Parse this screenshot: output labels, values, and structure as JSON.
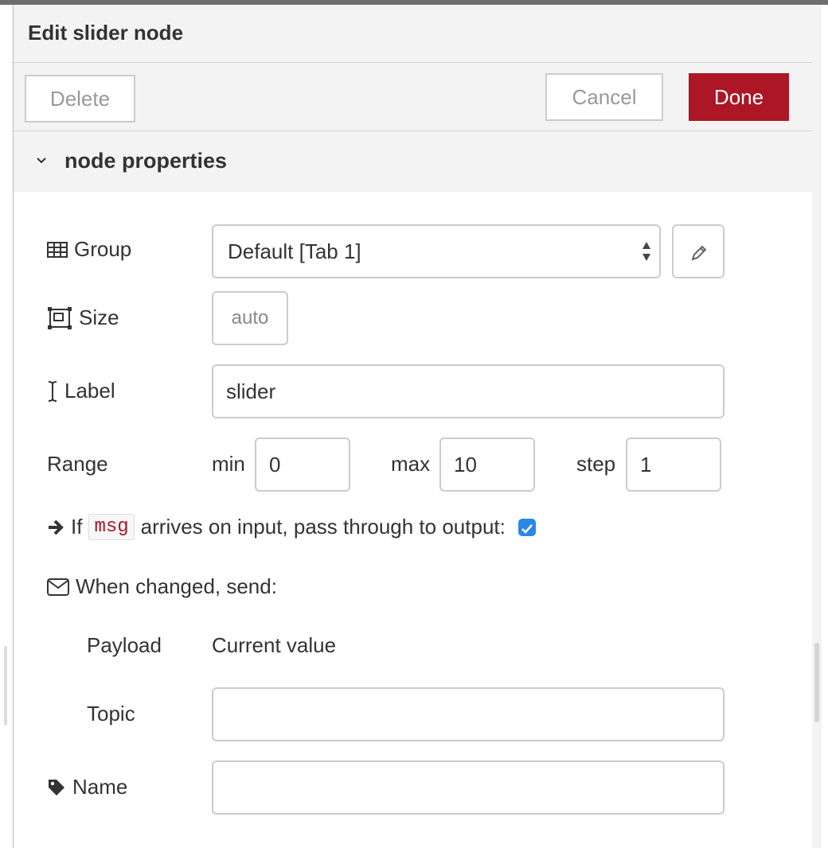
{
  "tray": {
    "title": "Edit slider node",
    "delete_label": "Delete",
    "cancel_label": "Cancel",
    "done_label": "Done"
  },
  "section": {
    "title": "node properties"
  },
  "form": {
    "group": {
      "label": "Group",
      "value": "Default [Tab 1]"
    },
    "size": {
      "label": "Size",
      "value": "auto"
    },
    "label": {
      "label": "Label",
      "value": "slider"
    },
    "range": {
      "label": "Range",
      "min_label": "min",
      "min_value": "0",
      "max_label": "max",
      "max_value": "10",
      "step_label": "step",
      "step_value": "1"
    },
    "passthrough": {
      "prefix": "If",
      "code": "msg",
      "suffix": "arrives on input, pass through to output:",
      "checked": true
    },
    "send": {
      "label": "When changed, send:",
      "payload_label": "Payload",
      "payload_value": "Current value",
      "topic_label": "Topic",
      "topic_value": ""
    },
    "name": {
      "label": "Name",
      "value": ""
    }
  },
  "colors": {
    "done_button": "#ad1625",
    "code_text": "#ad1625",
    "checkbox": "#2d87e6",
    "header_bg": "#f3f3f3"
  }
}
